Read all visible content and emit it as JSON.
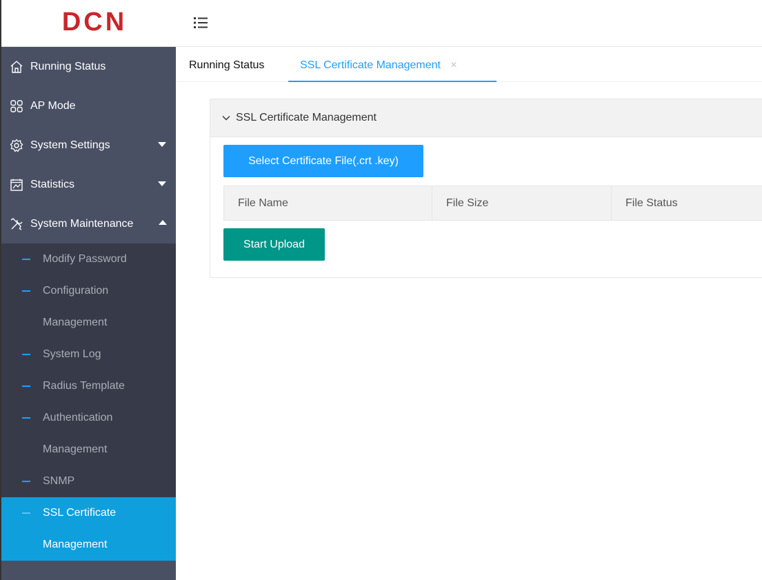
{
  "brand": {
    "logo_text": "DCN",
    "logo_color": "#c8262d"
  },
  "sidebar": {
    "items": [
      {
        "label": "Running Status",
        "icon": "home-icon"
      },
      {
        "label": "AP Mode",
        "icon": "grid-icon"
      },
      {
        "label": "System Settings",
        "icon": "gear-icon"
      },
      {
        "label": "Statistics",
        "icon": "calendar-chart-icon"
      },
      {
        "label": "System Maintenance",
        "icon": "tools-icon"
      }
    ],
    "submenu": [
      {
        "label": "Modify Password"
      },
      {
        "label": "Configuration",
        "label2": "Management"
      },
      {
        "label": "System Log"
      },
      {
        "label": "Radius Template"
      },
      {
        "label": "Authentication",
        "label2": "Management"
      },
      {
        "label": "SNMP"
      },
      {
        "label": "SSL Certificate",
        "label2": "Management"
      }
    ]
  },
  "tabs": [
    {
      "label": "Running Status"
    },
    {
      "label": "SSL Certificate Management",
      "close": "×"
    }
  ],
  "panel": {
    "title": "SSL Certificate Management",
    "select_button": "Select Certificate File(.crt .key)",
    "upload_button": "Start Upload",
    "columns": [
      "File Name",
      "File Size",
      "File Status"
    ]
  },
  "colors": {
    "accent": "#1e9fff",
    "sidebar_bg": "#4a5064",
    "submenu_bg": "#373b49",
    "selected_bg": "#0f9fdd",
    "upload_btn": "#009688"
  }
}
